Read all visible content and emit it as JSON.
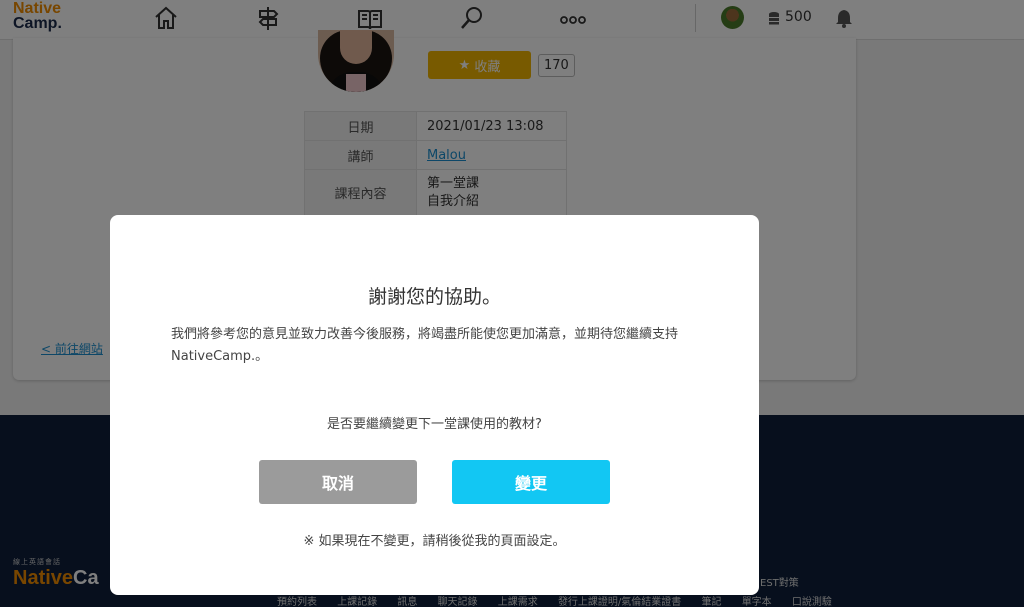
{
  "header": {
    "logo_line1": "Native",
    "logo_line2": "Camp.",
    "coins": "500",
    "icons": [
      "home-icon",
      "signpost-icon",
      "book-icon",
      "search-icon",
      "more-icon",
      "user-avatar",
      "coin-stack-icon",
      "bell-icon"
    ]
  },
  "lesson": {
    "favorite_label": "收藏",
    "favorite_count": "170",
    "rows": [
      {
        "label": "日期",
        "value": "2021/01/23 13:08"
      },
      {
        "label": "講師",
        "value": "Malou"
      },
      {
        "label": "課程內容",
        "value_line1": "第一堂課",
        "value_line2": "自我介紹"
      }
    ],
    "prev_link": "< 前往網站"
  },
  "footer": {
    "logo_tag": "線上英語會話",
    "logo_name_a": "Native",
    "logo_name_b": "Ca",
    "toeic": "EST對策",
    "links": [
      "預約列表",
      "上課記錄",
      "訊息",
      "聊天記錄",
      "上課需求",
      "發行上課證明/氣倫結業證書",
      "筆記",
      "單字本",
      "口說測驗"
    ]
  },
  "modal": {
    "title": "謝謝您的協助。",
    "body": "我們將參考您的意見並致力改善今後服務，將竭盡所能使您更加滿意，並期待您繼續支持NativeCamp.。",
    "question": "是否要繼續變更下一堂課使用的教材?",
    "cancel_label": "取消",
    "change_label": "變更",
    "note": "※ 如果現在不變更，請稍後從我的頁面設定。"
  },
  "colors": {
    "accent_blue": "#12c7f3",
    "cancel_gray": "#9b9b9b",
    "favorite_yellow": "#f0b400",
    "footer_navy": "#0e1f3a",
    "brand_orange": "#f08c00"
  }
}
